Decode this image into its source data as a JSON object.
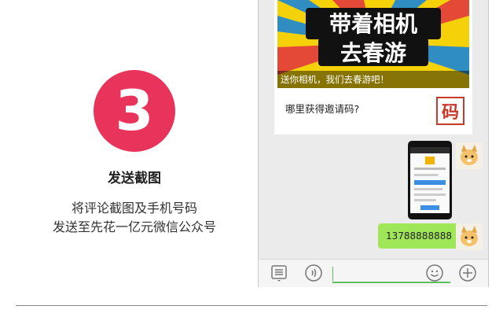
{
  "step": {
    "number": "3",
    "title": "发送截图",
    "description_lines": [
      "将评论截图及手机号码",
      "发送至先花一亿元微信公众号"
    ]
  },
  "chat": {
    "promo": {
      "banner_line1": "带着相机",
      "banner_line2": "去春游",
      "caption": "送你相机，我们去春游吧！",
      "question": "哪里获得邀请码?",
      "icon_char": "码"
    },
    "phone_message": "13788888888",
    "input_bar": {
      "menu_icon": "list-menu-icon",
      "voice_icon": "voice-icon",
      "emoji_icon": "emoji-icon",
      "plus_icon": "plus-icon"
    }
  },
  "colors": {
    "badge": "#e8345b",
    "bubble": "#9fe658",
    "accent_green": "#5bc25b"
  }
}
